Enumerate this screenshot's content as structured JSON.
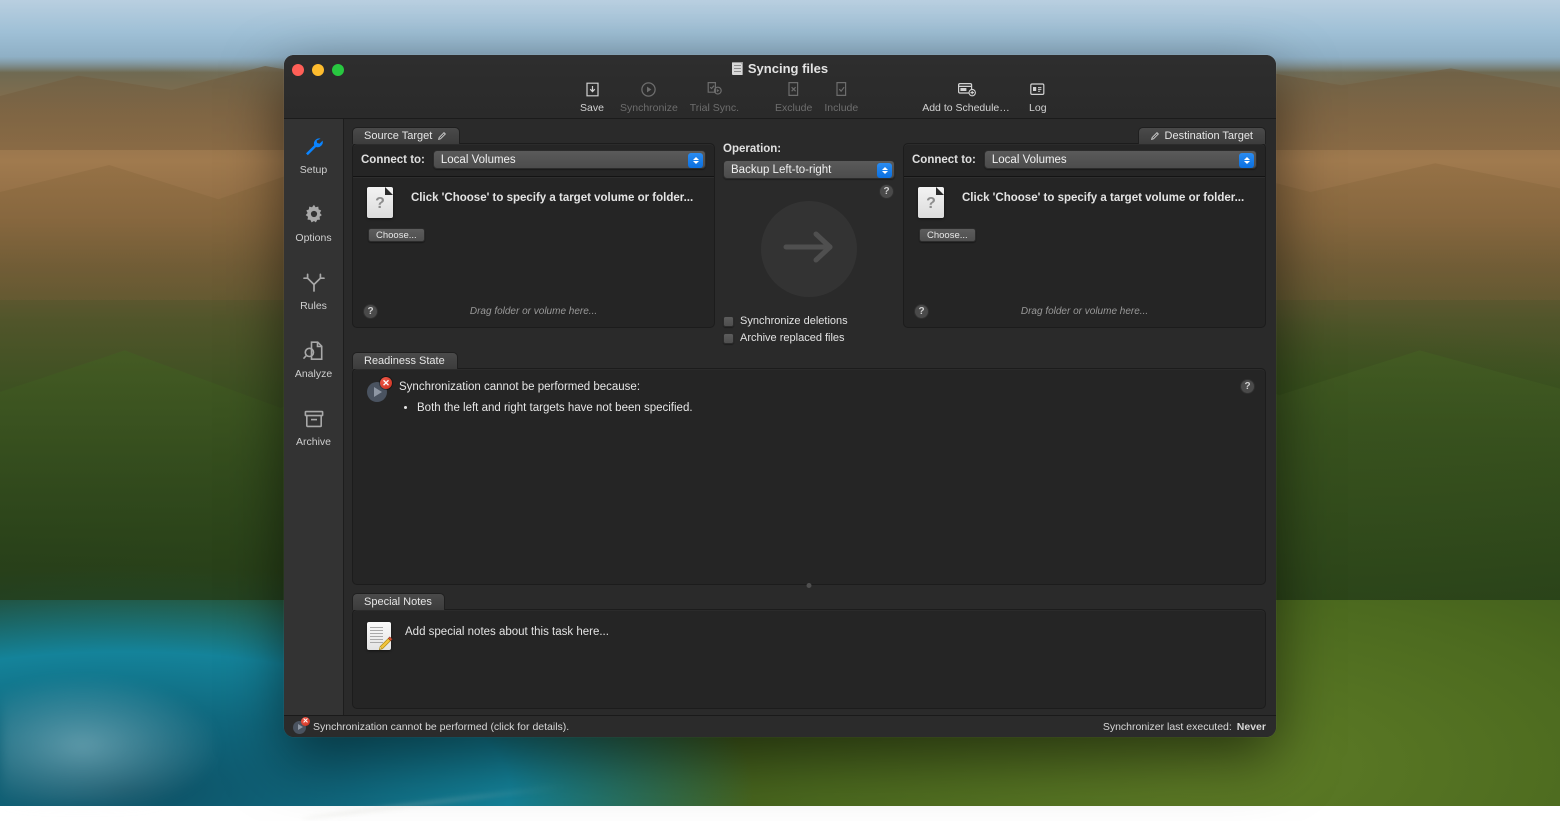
{
  "window": {
    "title": "Syncing files",
    "title_icon": "document-icon",
    "traffic_lights": [
      "close-button",
      "minimize-button",
      "zoom-button"
    ]
  },
  "toolbar": {
    "items": [
      {
        "label": "Save",
        "icon": "save-download-icon",
        "enabled": true
      },
      {
        "label": "Synchronize",
        "icon": "play-circle-icon",
        "enabled": false
      },
      {
        "label": "Trial Sync.",
        "icon": "trial-sync-icon",
        "enabled": false
      },
      {
        "label": "Exclude",
        "icon": "exclude-file-icon",
        "enabled": false
      },
      {
        "label": "Include",
        "icon": "include-file-icon",
        "enabled": false
      },
      {
        "label": "Add to Schedule…",
        "icon": "schedule-add-icon",
        "enabled": true
      },
      {
        "label": "Log",
        "icon": "log-icon",
        "enabled": true
      }
    ]
  },
  "sidebar": {
    "items": [
      {
        "label": "Setup",
        "icon": "wrench-icon",
        "selected": true
      },
      {
        "label": "Options",
        "icon": "gear-icon",
        "selected": false
      },
      {
        "label": "Rules",
        "icon": "branch-icon",
        "selected": false
      },
      {
        "label": "Analyze",
        "icon": "magnifier-document-icon",
        "selected": false
      },
      {
        "label": "Archive",
        "icon": "archive-box-icon",
        "selected": false
      }
    ]
  },
  "source_target": {
    "tab_label": "Source Target",
    "connect_label": "Connect to:",
    "connect_value": "Local Volumes",
    "message": "Click 'Choose' to specify a target volume or folder...",
    "choose_button": "Choose...",
    "drag_hint": "Drag folder or volume here...",
    "help": "?"
  },
  "destination_target": {
    "tab_label": "Destination Target",
    "connect_label": "Connect to:",
    "connect_value": "Local Volumes",
    "message": "Click 'Choose' to specify a target volume or folder...",
    "choose_button": "Choose...",
    "drag_hint": "Drag folder or volume here...",
    "help": "?"
  },
  "operation": {
    "label": "Operation:",
    "value": "Backup Left-to-right",
    "help": "?",
    "direction_icon": "arrow-right-icon",
    "checkboxes": [
      {
        "label": "Synchronize deletions",
        "checked": false
      },
      {
        "label": "Archive replaced files",
        "checked": false
      }
    ]
  },
  "readiness": {
    "tab_label": "Readiness State",
    "headline": "Synchronization cannot be performed because:",
    "reasons": [
      "Both the left and right targets have not been specified."
    ],
    "help": "?",
    "badge_icon": "play-error-icon"
  },
  "notes": {
    "tab_label": "Special Notes",
    "placeholder": "Add special notes about this task here...",
    "icon": "note-pencil-icon"
  },
  "statusbar": {
    "message": "Synchronization cannot be performed (click for details).",
    "last_executed_label": "Synchronizer last executed:",
    "last_executed_value": "Never",
    "badge_icon": "play-error-icon"
  },
  "colors": {
    "accent_blue": "#0a6fe0",
    "error_red": "#c92d1c",
    "window_bg": "#2a2a2a",
    "panel_bg": "#252525",
    "sidebar_bg": "#333333"
  }
}
